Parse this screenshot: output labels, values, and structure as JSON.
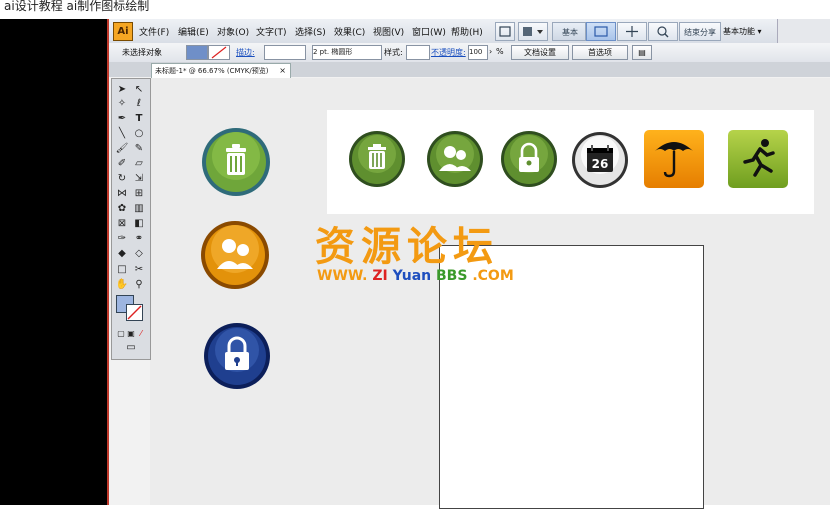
{
  "window": {
    "title": "ai设计教程 ai制作图标绘制"
  },
  "app": {
    "logo_text": "Ai"
  },
  "menu": {
    "items": [
      "文件(F)",
      "编辑(E)",
      "对象(O)",
      "文字(T)",
      "选择(S)",
      "效果(C)",
      "视图(V)",
      "窗口(W)",
      "帮助(H)"
    ],
    "workspace_left": "基本",
    "workspace_right": "结束分享",
    "workspace_menu": "基本功能 ▾"
  },
  "control_bar": {
    "selection_label": "未选择对象",
    "stroke_label": "描边:",
    "stroke_width_value": "2 pt. 椭圆形",
    "style_label": "样式:",
    "opacity_label": "不透明度:",
    "opacity_value": "100",
    "opacity_unit": "%",
    "document_setup_button": "文档设置",
    "preferences_button": "首选项"
  },
  "document_tab": {
    "label": "未标题-1* @ 66.67% (CMYK/预览)",
    "close": "×"
  },
  "canvas_icons": {
    "left_column": [
      "trash-icon",
      "user-group-icon",
      "lock-icon"
    ],
    "panel_row": [
      "trash-icon",
      "user-group-icon",
      "lock-icon",
      "calendar-icon",
      "umbrella-icon",
      "runner-icon"
    ],
    "calendar_number": "26"
  },
  "watermark": {
    "chinese": "资源论坛",
    "url_part1": "WWW.",
    "url_part2": "ZI",
    "url_part3": "Yuan",
    "url_part4": "BBS",
    "url_part5": ".COM"
  },
  "colors": {
    "menubar": "#e2e7ee",
    "green_icon": "#4f7f1f",
    "orange_icon": "#e38f00",
    "blue_icon": "#1f3f8f",
    "watermark_orange": "#f39a12",
    "watermark_blue": "#1f4fbf",
    "watermark_green": "#3a9a2a"
  }
}
